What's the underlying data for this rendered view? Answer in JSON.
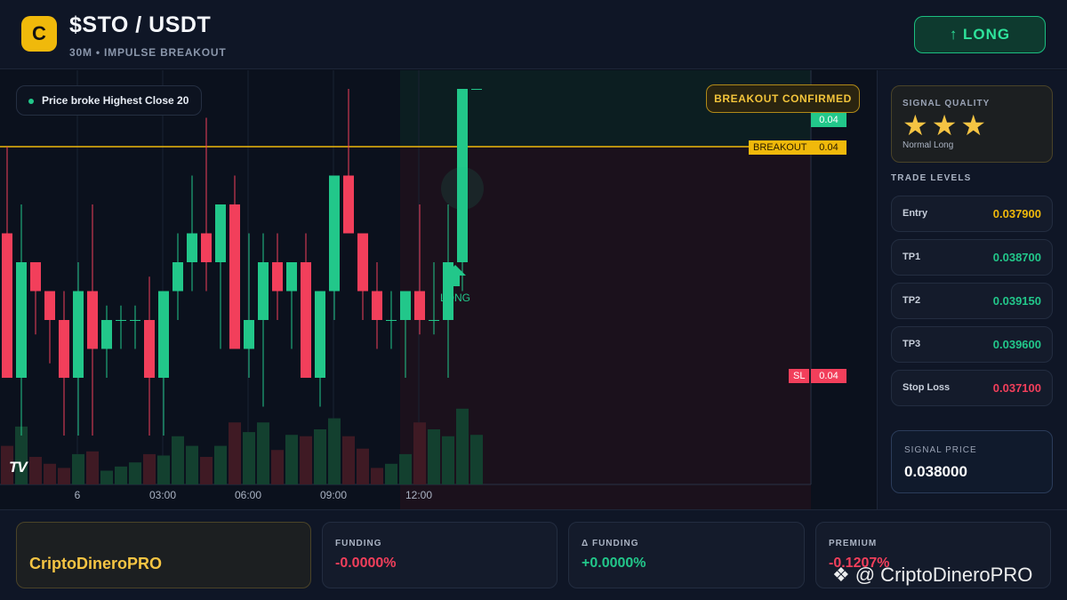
{
  "header": {
    "logo_letter": "C",
    "pair": "$STO / USDT",
    "subtitle": "30M • IMPULSE BREAKOUT",
    "long_button": "↑ LONG"
  },
  "chart": {
    "price_pill": "Price broke Highest Close 20",
    "breakout_badge": "BREAKOUT CONFIRMED",
    "tag_current": "0.04",
    "tag_breakout_label": "BREAKOUT",
    "tag_breakout_value": "0.04",
    "tag_sl_label": "SL",
    "tag_sl_value": "0.04",
    "long_marker": "LONG",
    "tv_logo": "TV",
    "time_labels": [
      "6",
      "03:00",
      "06:00",
      "09:00",
      "12:00"
    ],
    "colors": {
      "up": "#22c78a",
      "down": "#f23f5b",
      "breakout": "#f0b90b"
    }
  },
  "chart_data": {
    "type": "candlestick",
    "candles": [
      {
        "o": 0.0381,
        "h": 0.0384,
        "l": 0.0376,
        "c": 0.0376
      },
      {
        "o": 0.0376,
        "h": 0.0382,
        "l": 0.0374,
        "c": 0.038
      },
      {
        "o": 0.038,
        "h": 0.0379,
        "l": 0.03775,
        "c": 0.0379
      },
      {
        "o": 0.0379,
        "h": 0.0378,
        "l": 0.03765,
        "c": 0.0378
      },
      {
        "o": 0.0378,
        "h": 0.0379,
        "l": 0.0374,
        "c": 0.0376
      },
      {
        "o": 0.0376,
        "h": 0.038,
        "l": 0.0374,
        "c": 0.0379
      },
      {
        "o": 0.0379,
        "h": 0.0382,
        "l": 0.0374,
        "c": 0.0377
      },
      {
        "o": 0.0377,
        "h": 0.03785,
        "l": 0.0376,
        "c": 0.0378
      },
      {
        "o": 0.0378,
        "h": 0.03785,
        "l": 0.0377,
        "c": 0.0378
      },
      {
        "o": 0.0378,
        "h": 0.03785,
        "l": 0.0377,
        "c": 0.0378
      },
      {
        "o": 0.0378,
        "h": 0.03795,
        "l": 0.0374,
        "c": 0.0376
      },
      {
        "o": 0.0376,
        "h": 0.0379,
        "l": 0.0374,
        "c": 0.0379
      },
      {
        "o": 0.0379,
        "h": 0.0381,
        "l": 0.0378,
        "c": 0.038
      },
      {
        "o": 0.038,
        "h": 0.0383,
        "l": 0.0379,
        "c": 0.0381
      },
      {
        "o": 0.0381,
        "h": 0.0385,
        "l": 0.0379,
        "c": 0.038
      },
      {
        "o": 0.038,
        "h": 0.0382,
        "l": 0.0377,
        "c": 0.0382
      },
      {
        "o": 0.0382,
        "h": 0.0383,
        "l": 0.0377,
        "c": 0.0377
      },
      {
        "o": 0.0377,
        "h": 0.0381,
        "l": 0.0376,
        "c": 0.0378
      },
      {
        "o": 0.0378,
        "h": 0.0381,
        "l": 0.0375,
        "c": 0.038
      },
      {
        "o": 0.038,
        "h": 0.0381,
        "l": 0.0378,
        "c": 0.0379
      },
      {
        "o": 0.0379,
        "h": 0.038,
        "l": 0.0377,
        "c": 0.038
      },
      {
        "o": 0.038,
        "h": 0.0381,
        "l": 0.0376,
        "c": 0.0376
      },
      {
        "o": 0.0376,
        "h": 0.0379,
        "l": 0.0375,
        "c": 0.0379
      },
      {
        "o": 0.0379,
        "h": 0.0383,
        "l": 0.0378,
        "c": 0.0383
      },
      {
        "o": 0.0383,
        "h": 0.0386,
        "l": 0.0381,
        "c": 0.0381
      },
      {
        "o": 0.0381,
        "h": 0.0381,
        "l": 0.0378,
        "c": 0.0379
      },
      {
        "o": 0.0379,
        "h": 0.038,
        "l": 0.0377,
        "c": 0.0378
      },
      {
        "o": 0.0378,
        "h": 0.0379,
        "l": 0.0377,
        "c": 0.0378
      },
      {
        "o": 0.0378,
        "h": 0.0379,
        "l": 0.0376,
        "c": 0.0379
      },
      {
        "o": 0.0379,
        "h": 0.0382,
        "l": 0.03775,
        "c": 0.0378
      },
      {
        "o": 0.0378,
        "h": 0.038,
        "l": 0.03775,
        "c": 0.0378
      },
      {
        "o": 0.0378,
        "h": 0.0382,
        "l": 0.0376,
        "c": 0.038
      },
      {
        "o": 0.038,
        "h": 0.0386,
        "l": 0.0379,
        "c": 0.0386
      },
      {
        "o": 0.0386,
        "h": 0.0386,
        "l": 0.0386,
        "c": 0.0386
      }
    ],
    "volume": [
      28,
      42,
      20,
      15,
      12,
      22,
      24,
      10,
      13,
      16,
      22,
      21,
      35,
      28,
      20,
      28,
      45,
      38,
      45,
      25,
      36,
      35,
      40,
      48,
      35,
      26,
      12,
      15,
      22,
      45,
      40,
      35,
      55,
      36
    ],
    "breakout_level": 0.0384,
    "stop_loss": 0.0371,
    "long_signal_index": 32,
    "x_ticks": [
      "6",
      "03:00",
      "06:00",
      "09:00",
      "12:00"
    ]
  },
  "quality": {
    "title": "SIGNAL QUALITY",
    "stars": "★★★",
    "rating": 3,
    "subtitle": "Normal Long"
  },
  "levels": {
    "title": "TRADE LEVELS",
    "items": [
      {
        "name": "Entry",
        "value": "0.037900",
        "color": "#f0b90b"
      },
      {
        "name": "TP1",
        "value": "0.038700",
        "color": "#22c78a"
      },
      {
        "name": "TP2",
        "value": "0.039150",
        "color": "#22c78a"
      },
      {
        "name": "TP3",
        "value": "0.039600",
        "color": "#22c78a"
      },
      {
        "name": "Stop Loss",
        "value": "0.037100",
        "color": "#f23f5b"
      }
    ]
  },
  "signal_price": {
    "label": "SIGNAL PRICE",
    "value": "0.038000"
  },
  "footer": {
    "brand": "CriptoDineroPRO",
    "stats": [
      {
        "label": "FUNDING",
        "value": "-0.0000%",
        "color": "#f23f5b"
      },
      {
        "label": "Δ FUNDING",
        "value": "+0.0000%",
        "color": "#22c78a"
      },
      {
        "label": "PREMIUM",
        "value": "-0.1207%",
        "color": "#f23f5b"
      }
    ],
    "watermark": "@ CriptoDineroPRO"
  }
}
